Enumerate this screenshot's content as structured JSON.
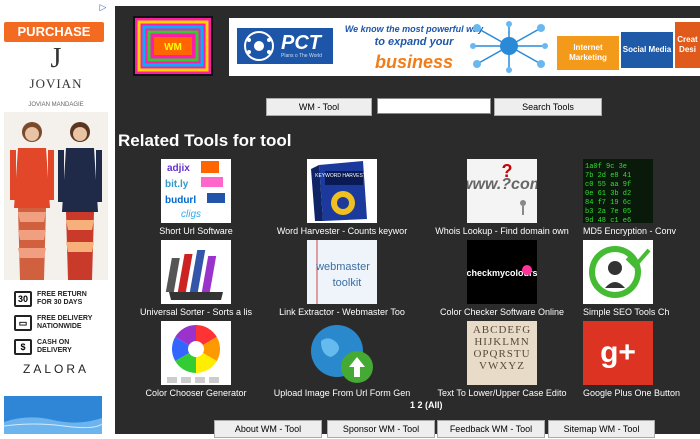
{
  "ad": {
    "close_label": "▷",
    "purchase_label": "PURCHASE NOW",
    "logo_letter": "J",
    "brand": "JOVIAN",
    "brand_sub": "JOVIAN MANDAGIE",
    "badges": [
      {
        "icon": "30",
        "text": "FREE RETURN FOR 30 DAYS"
      },
      {
        "icon": "▭",
        "text": "FREE DELIVERY NATIONWIDE"
      },
      {
        "icon": "$",
        "text": "CASH ON DELIVERY"
      }
    ],
    "store": "ZALORA"
  },
  "banner": {
    "pct_logo": "PCT",
    "pct_tagline": "Plans o The World",
    "line1": "We know the most powerful way",
    "line2": "to expand your",
    "line3": "business",
    "tile_internet": "Internet Marketing",
    "tile_social": "Social Media",
    "tile_creative": "Creat Desi"
  },
  "search": {
    "wm_tool_label": "WM - Tool",
    "input_value": "",
    "search_button_label": "Search Tools"
  },
  "heading": "Related Tools for tool",
  "tools": [
    {
      "label": "Short Url Software",
      "icon": "short-url-icon"
    },
    {
      "label": "Word Harvester - Counts keywor",
      "icon": "keyword-harvester-icon"
    },
    {
      "label": "Whois Lookup - Find domain own",
      "icon": "whois-icon"
    },
    {
      "label": "MD5 Encryption - Conv",
      "icon": "md5-matrix-icon"
    },
    {
      "label": "Universal Sorter - Sorts a lis",
      "icon": "sorter-icon"
    },
    {
      "label": "Link Extractor - Webmaster Too",
      "icon": "webmaster-toolkit-icon"
    },
    {
      "label": "Color Checker Software Online",
      "icon": "checkmycolours-icon"
    },
    {
      "label": "Simple SEO Tools Ch",
      "icon": "seo-check-icon"
    },
    {
      "label": "Color Chooser Generator",
      "icon": "color-wheel-icon"
    },
    {
      "label": "Upload Image From Url Form Gen",
      "icon": "upload-globe-icon"
    },
    {
      "label": "Text To Lower/Upper Case Edito",
      "icon": "alphabet-icon"
    },
    {
      "label": "Google Plus One Button",
      "icon": "google-plus-icon"
    }
  ],
  "thumb_text": {
    "keyword_harvester": "KEYWORD HARVESTER",
    "www": "www.?com",
    "webmaster_toolkit": "webmaster toolkit",
    "checkmycolours": "checkmycolours",
    "alphabet": "ABCDEFGHIJKLMNOPQRSTUVWXYZ",
    "gplus": "g+"
  },
  "pager": "1 2 (All)",
  "footer": {
    "about": "About WM - Tool",
    "sponsor": "Sponsor WM - Tool",
    "feedback": "Feedback WM - Tool",
    "sitemap": "Sitemap WM - Tool"
  },
  "colors": {
    "background_dark": "#2b2b2b",
    "purchase_orange": "#f26b21",
    "banner_blue": "#1d56a8",
    "banner_orange": "#f07d1a"
  }
}
